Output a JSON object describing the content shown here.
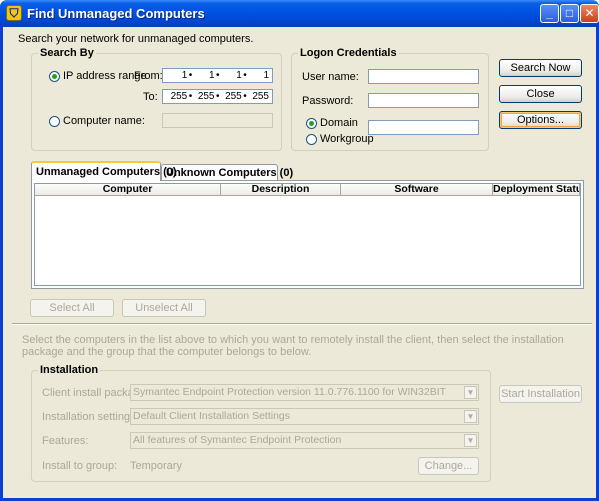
{
  "window": {
    "title": "Find Unmanaged Computers",
    "icon": "shield-icon"
  },
  "description": "Search your network for unmanaged computers.",
  "search_by": {
    "title": "Search By",
    "ip_range_label": "IP address range",
    "from_label": "From:",
    "to_label": "To:",
    "from_ip": [
      "1",
      "1",
      "1",
      "1"
    ],
    "to_ip": [
      "255",
      "255",
      "255",
      "255"
    ],
    "computer_name_label": "Computer name:",
    "computer_name_value": "",
    "selected": "ip_range"
  },
  "logon": {
    "title": "Logon Credentials",
    "user_label": "User name:",
    "user_value": "",
    "password_label": "Password:",
    "password_value": "",
    "domain_label": "Domain",
    "workgroup_label": "Workgroup",
    "domain_value": "",
    "selected": "domain"
  },
  "actions": {
    "search_now": "Search Now",
    "close": "Close",
    "options": "Options..."
  },
  "tabs": [
    {
      "label": "Unmanaged Computers (0)",
      "active": true
    },
    {
      "label": "Unknown Computers (0)",
      "active": false
    }
  ],
  "table": {
    "columns": [
      "Computer",
      "Description",
      "Software",
      "Deployment Status"
    ],
    "rows": []
  },
  "select_all": "Select All",
  "unselect_all": "Unselect All",
  "instructions": "Select the computers in the list above to which you want to remotely install the client, then select the installation package and the group that the computer belongs to below.",
  "installation": {
    "title": "Installation",
    "package_label": "Client install package:",
    "package_value": "Symantec Endpoint Protection version 11.0.776.1100 for WIN32BIT",
    "settings_label": "Installation settings:",
    "settings_value": "Default Client Installation Settings",
    "features_label": "Features:",
    "features_value": "All features of Symantec Endpoint Protection",
    "group_label": "Install to group:",
    "group_value": "Temporary",
    "change_button": "Change...",
    "start_button": "Start Installation"
  },
  "colors": {
    "titlebar": "#0052e0",
    "window_bg": "#ece9d8",
    "active_tab_accent": "#ffc83c"
  }
}
